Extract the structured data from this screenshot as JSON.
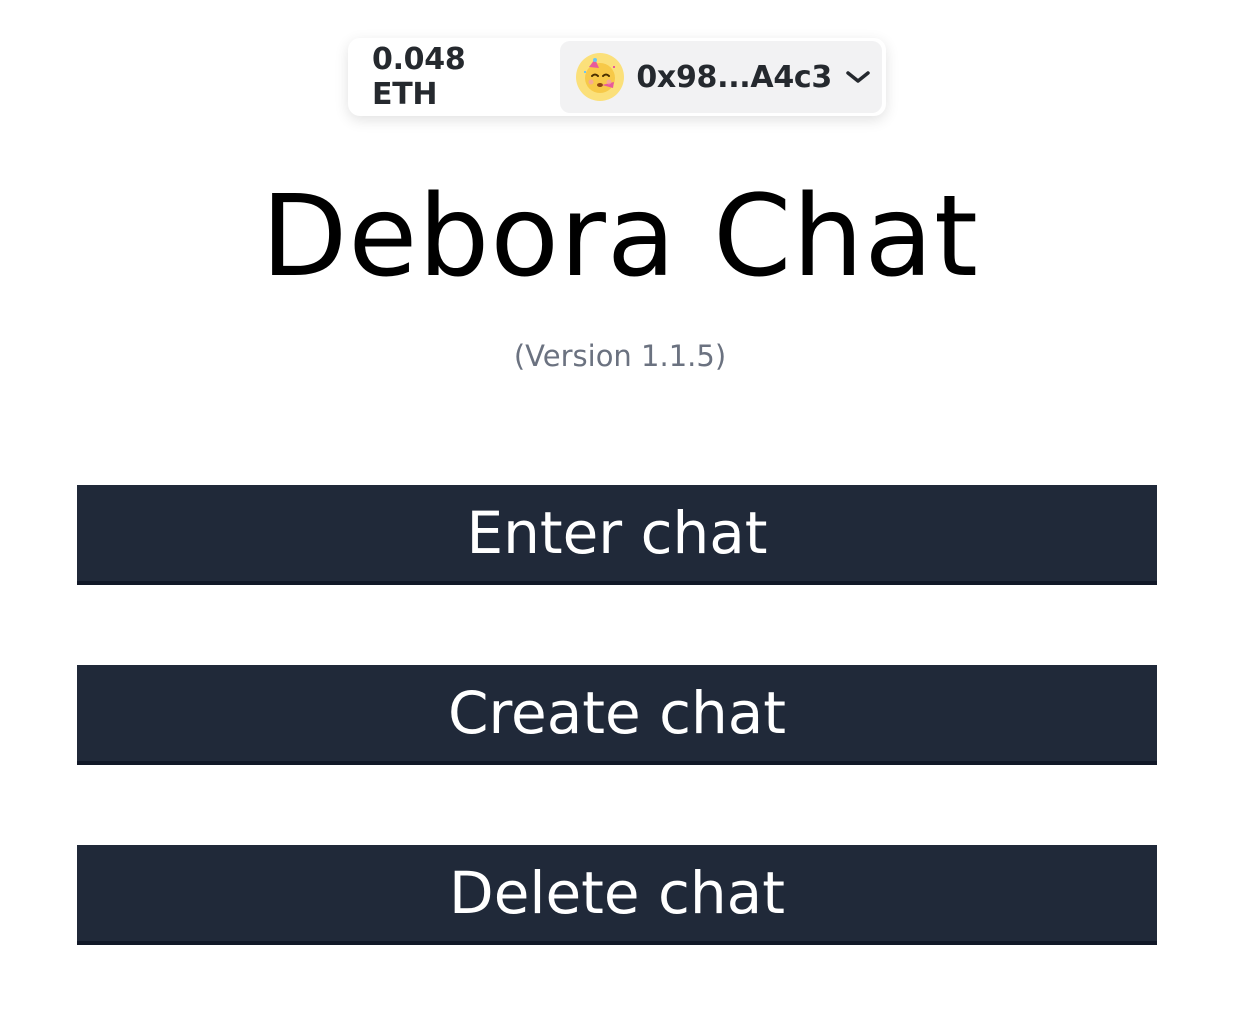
{
  "wallet": {
    "balance": "0.048 ETH",
    "address": "0x98...A4c3",
    "avatar_emoji": "🥳",
    "avatar_bg": "#fbe07a"
  },
  "header": {
    "title": "Debora Chat",
    "version": "(Version 1.1.5)"
  },
  "actions": {
    "enter_label": "Enter chat",
    "create_label": "Create chat",
    "delete_label": "Delete chat"
  },
  "colors": {
    "button_bg": "#202939",
    "button_text": "#ffffff",
    "version_text": "#6b7280"
  },
  "icons": {
    "account_dropdown": "chevron-down-icon",
    "avatar": "party-face-emoji"
  }
}
